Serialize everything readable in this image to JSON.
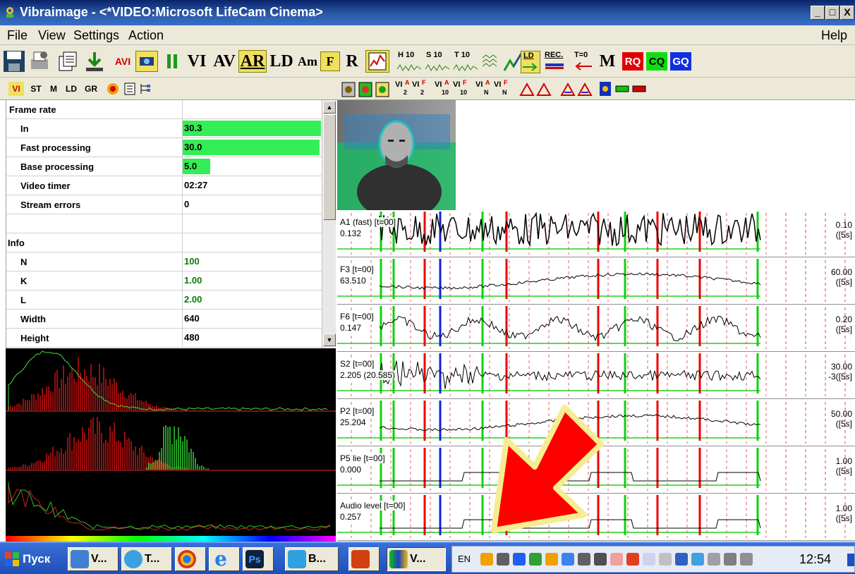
{
  "window": {
    "title": "Vibraimage - <*VIDEO:Microsoft LifeCam Cinema>",
    "min": "_",
    "max": "□",
    "close": "X"
  },
  "menu": {
    "file": "File",
    "view": "View",
    "settings": "Settings",
    "action": "Action",
    "help": "Help"
  },
  "toolbar1": {
    "avi": "AVI",
    "vi": "VI",
    "av": "AV",
    "ar": "AR",
    "ld": "LD",
    "am": "Am",
    "f": "F",
    "r": "R",
    "h10": "H 10",
    "s10": "S 10",
    "t10": "T 10",
    "ld_small": "LD",
    "rec": "REC.",
    "t0": "T=0",
    "m": "M",
    "rq": "RQ",
    "cq": "CQ",
    "gq": "GQ"
  },
  "toolbar2": {
    "vi": "VI",
    "st": "ST",
    "m": "M",
    "ld": "LD",
    "gr": "GR",
    "vi2a": "VI",
    "vi2b": "VI",
    "vi10a": "VI",
    "vi10b": "VI",
    "vina": "VI",
    "vinb": "VI",
    "sub2": "2",
    "sub10": "10",
    "subn": "N",
    "supa": "A",
    "supf": "F"
  },
  "props": {
    "frame_rate": "Frame rate",
    "rows": [
      {
        "key": "In",
        "value": "30.3",
        "fill": 1.0
      },
      {
        "key": "Fast processing",
        "value": "30.0",
        "fill": 0.99
      },
      {
        "key": "Base processing",
        "value": "5.0",
        "fill": 0.2
      },
      {
        "key": "Video timer",
        "value": "02:27"
      },
      {
        "key": "Stream errors",
        "value": "0"
      }
    ],
    "info": "Info",
    "info_rows": [
      {
        "key": "N",
        "value": "100"
      },
      {
        "key": "K",
        "value": "1.00"
      },
      {
        "key": "L",
        "value": "2.00"
      },
      {
        "key": "Width",
        "value": "640"
      },
      {
        "key": "Height",
        "value": "480"
      }
    ]
  },
  "charts": [
    {
      "name": "A1 (fast) [t=00]",
      "value": "0.132",
      "scale": "0.10",
      "period": "([5s]"
    },
    {
      "name": "F3 [t=00]",
      "value": "63.510",
      "scale": "60.00",
      "period": "([5s]"
    },
    {
      "name": "F6 [t=00]",
      "value": "0.147",
      "scale": "0.20",
      "period": "([5s]"
    },
    {
      "name": "S2 [t=00]",
      "value": "2.205 (20.585)",
      "scale": "30.00",
      "period": "-3([5s]"
    },
    {
      "name": "P2 [t=00]",
      "value": "25.204",
      "scale": "50.00",
      "period": "([5s]"
    },
    {
      "name": "P5 lie [t=00]",
      "value": "0.000",
      "scale": "1.00",
      "period": "([5s]"
    },
    {
      "name": "Audio level [t=00]",
      "value": "0.257",
      "scale": "1.00",
      "period": "([5s]"
    }
  ],
  "taskbar": {
    "start": "Пуск",
    "items": [
      "V...",
      "T...",
      "",
      "",
      "Ps",
      "B...",
      "",
      "V..."
    ],
    "lang": "EN",
    "clock": "12:54"
  },
  "colors": {
    "accent_red": "#ff0000",
    "marker_green": "#00cc00",
    "marker_blue": "#0000ff",
    "fill_green": "#33ee55"
  }
}
